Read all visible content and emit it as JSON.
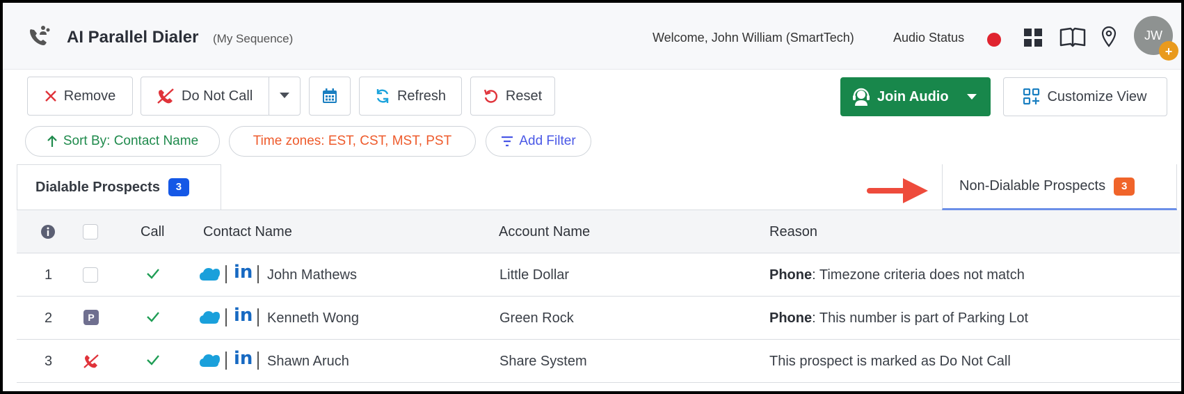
{
  "header": {
    "app_title": "AI Parallel Dialer",
    "app_subtitle": "(My Sequence)",
    "welcome_prefix": "Welcome, John William",
    "welcome_org": "(SmartTech)",
    "audio_status_label": "Audio Status",
    "audio_status_color": "#e0242f",
    "avatar_initials": "JW",
    "avatar_badge": "+"
  },
  "toolbar": {
    "remove_label": "Remove",
    "dnc_label": "Do Not Call",
    "refresh_label": "Refresh",
    "reset_label": "Reset",
    "join_audio_label": "Join Audio",
    "customize_view_label": "Customize View"
  },
  "filters": {
    "sort_label": "Sort By: Contact Name",
    "timezones_label": "Time zones: EST, CST, MST, PST",
    "add_filter_label": "Add Filter"
  },
  "tabs": [
    {
      "label": "Dialable Prospects",
      "count": "3",
      "active": false
    },
    {
      "label": "Non-Dialable Prospects",
      "count": "3",
      "active": true
    }
  ],
  "table": {
    "headers": {
      "call": "Call",
      "contact": "Contact Name",
      "account": "Account Name",
      "reason": "Reason"
    },
    "rows": [
      {
        "num": "1",
        "status": "checkbox",
        "contact": "John Mathews",
        "account": "Little Dollar",
        "reason_prefix": "Phone",
        "reason_text": ": Timezone criteria does not match"
      },
      {
        "num": "2",
        "status": "parking-lot",
        "status_label": "P",
        "contact": "Kenneth Wong",
        "account": "Green Rock",
        "reason_prefix": "Phone",
        "reason_text": ": This number is part of Parking Lot"
      },
      {
        "num": "3",
        "status": "do-not-call",
        "contact": "Shawn Aruch",
        "account": "Share System",
        "reason_prefix": "",
        "reason_text": "This prospect is marked as Do Not Call"
      }
    ],
    "linkedin_label": "in"
  },
  "colors": {
    "join_audio": "#18874b",
    "dialable_badge": "#1558e6",
    "non_dialable_badge": "#f0642a",
    "annotation_arrow": "#ee4b3c"
  }
}
